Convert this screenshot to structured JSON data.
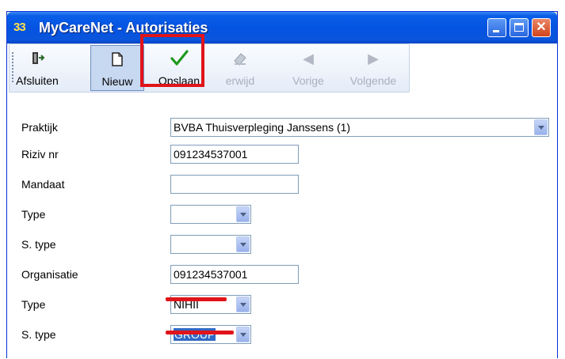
{
  "window": {
    "title": "MyCareNet - Autorisaties",
    "icon_text": "33",
    "buttons": [
      {
        "name": "minimize",
        "icon": "minimize-icon"
      },
      {
        "name": "maximize",
        "icon": "maximize-icon"
      },
      {
        "name": "close",
        "icon": "close-icon"
      }
    ]
  },
  "toolbar": {
    "afsluiten_label": "Afsluiten",
    "nieuw_label": "Nieuw",
    "opslaan_label": "Opslaan",
    "verwijder_label": "erwijd",
    "vorige_label": "Vorige",
    "volgende_label": "Volgende"
  },
  "form": {
    "praktijk": {
      "label": "Praktijk",
      "value": "BVBA Thuisverpleging Janssens  (1)"
    },
    "riziv": {
      "label": "Riziv nr",
      "value": "091234537001"
    },
    "mandaat": {
      "label": "Mandaat",
      "value": ""
    },
    "type1": {
      "label": "Type",
      "value": ""
    },
    "stype1": {
      "label": "S. type",
      "value": ""
    },
    "organisatie": {
      "label": "Organisatie",
      "value": "091234537001"
    },
    "type2": {
      "label": "Type",
      "value": "NIHII"
    },
    "stype2": {
      "label": "S. type",
      "value": "GROUP"
    }
  },
  "colors": {
    "titlebar": "#0454e2",
    "annotation": "#e0141a",
    "selection": "#316ac5"
  }
}
